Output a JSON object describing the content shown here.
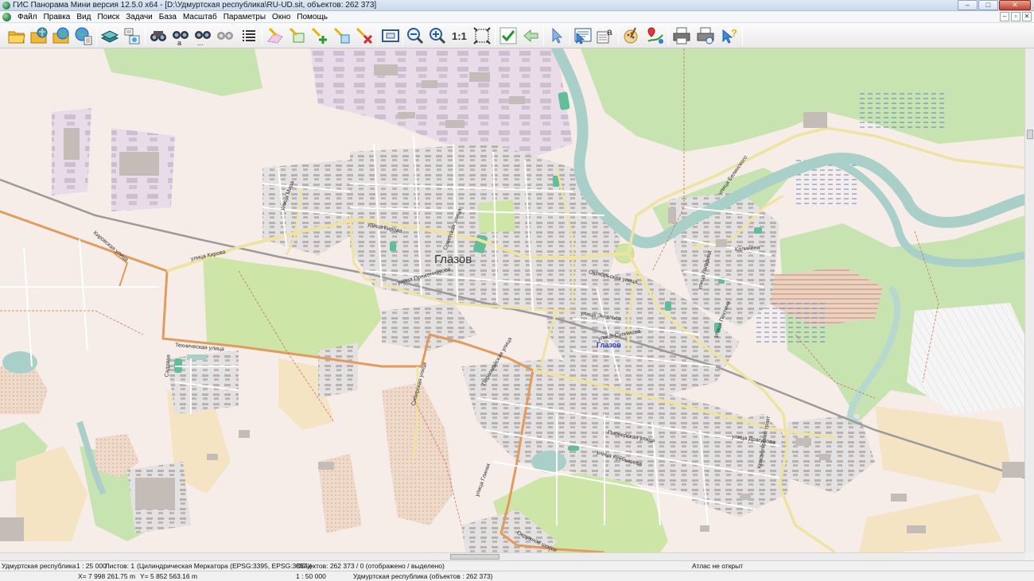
{
  "window": {
    "title": "ГИС Панорама Мини версия 12.5.0 x64 - [D:\\Удмуртская республика\\RU-UD.sit, объектов: 262 373]",
    "controls": [
      "–",
      "□",
      "✕"
    ]
  },
  "menu": {
    "items": [
      "Файл",
      "Правка",
      "Вид",
      "Поиск",
      "Задачи",
      "База",
      "Масштаб",
      "Параметры",
      "Окно",
      "Помощь"
    ],
    "mdi_controls": [
      "–",
      "▫",
      "✕"
    ]
  },
  "toolbar": {
    "buttons": [
      "open-folder",
      "open-data",
      "open-map",
      "map-info",
      "layers",
      "legend",
      "binoculars",
      "binoculars-a",
      "binoculars-more",
      "binoculars-grey",
      "list",
      "select-pen",
      "select-area",
      "add-object",
      "edit-object",
      "delete-object",
      "view-window",
      "zoom-out",
      "zoom-in",
      "scale-1-1",
      "zoom-extent",
      "apply",
      "back",
      "pointer",
      "object-info",
      "text-info",
      "paint",
      "route",
      "print",
      "print-preview",
      "help-pointer"
    ],
    "scale_label": "1:1"
  },
  "map": {
    "city_label": "Глазов",
    "station_label": "Глазов",
    "streets": [
      "Кировская улица",
      "улица Кирова",
      "улица Пряженникова",
      "Техническая улица",
      "Советская улица",
      "Сибирская улица",
      "Первомайская улица",
      "улица Кирова",
      "улица Гагарина",
      "улица Драгунова",
      "Калинина",
      "Октябрьская улица",
      "улица Энгельса",
      "улица Сулимова",
      "Пионерская улица",
      "улица Куйбышева",
      "Окружное шоссе",
      "улица Белинского",
      "улица Мира",
      "Красногорский тракт",
      "улица Пехтина",
      "Садовая",
      "улица Глинки"
    ],
    "colors": {
      "background": "#f6ede9",
      "forest": "#c7e3b0",
      "park": "#cde6a8",
      "water": "#a9d0c8",
      "industrial": "#e7dbe8",
      "residential": "#e5e3e3",
      "building": "#bfb7b2",
      "main_road": "#efe3a0",
      "trunk_road": "#e39b5a"
    }
  },
  "status": {
    "region": "Удмуртская республика",
    "scale": "1 : 25 000",
    "sheets": "Листов: 1",
    "projection": "(Цилиндрическая Меркатора (EPSG:3395, EPSG:3857))",
    "objects": "Объектов: 262 373 / 0 (отображено / выделено)",
    "atlas": "Атлас не открыт",
    "x": "X= 7 998 261.75 m",
    "y": "Y= 5 852 563.16 m",
    "scale2": "1 : 50 000",
    "region_objects": "Удмуртская республика   (объектов : 262 373)"
  }
}
